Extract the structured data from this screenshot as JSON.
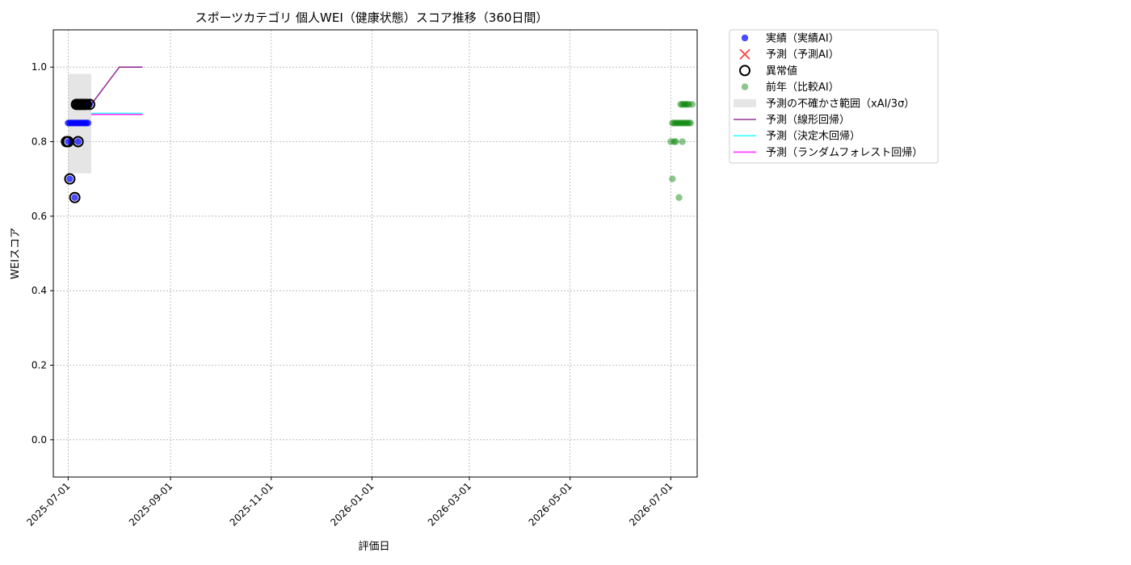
{
  "chart_data": {
    "type": "scatter",
    "title": "スポーツカテゴリ 個人WEI（健康状態）スコア推移（360日間）",
    "xlabel": "評価日",
    "ylabel": "WEIスコア",
    "x_type": "date",
    "xlim": [
      "2025-06-22",
      "2026-07-17"
    ],
    "ylim": [
      -0.1,
      1.1
    ],
    "x_ticks": [
      "2025-07-01",
      "2025-09-01",
      "2025-11-01",
      "2026-01-01",
      "2026-03-01",
      "2026-05-01",
      "2026-07-01"
    ],
    "y_ticks": [
      0.0,
      0.2,
      0.4,
      0.6,
      0.8,
      1.0
    ],
    "y_tick_labels": [
      "0.0",
      "0.2",
      "0.4",
      "0.6",
      "0.8",
      "1.0"
    ],
    "grid": true,
    "legend_position": "outside-top-right",
    "series": [
      {
        "name": "実績（実績AI）",
        "kind": "scatter",
        "color": "#0000ff",
        "points": [
          [
            "2025-07-01",
            0.85
          ],
          [
            "2025-07-01",
            0.8
          ],
          [
            "2025-07-02",
            0.85
          ],
          [
            "2025-07-02",
            0.7
          ],
          [
            "2025-07-03",
            0.85
          ],
          [
            "2025-07-03",
            0.8
          ],
          [
            "2025-07-04",
            0.85
          ],
          [
            "2025-07-05",
            0.65
          ],
          [
            "2025-07-05",
            0.85
          ],
          [
            "2025-07-06",
            0.85
          ],
          [
            "2025-07-06",
            0.9
          ],
          [
            "2025-07-07",
            0.8
          ],
          [
            "2025-07-07",
            0.85
          ],
          [
            "2025-07-08",
            0.85
          ],
          [
            "2025-07-08",
            0.9
          ],
          [
            "2025-07-09",
            0.85
          ],
          [
            "2025-07-09",
            0.9
          ],
          [
            "2025-07-10",
            0.85
          ],
          [
            "2025-07-10",
            0.9
          ],
          [
            "2025-07-11",
            0.85
          ],
          [
            "2025-07-11",
            0.9
          ],
          [
            "2025-07-12",
            0.85
          ],
          [
            "2025-07-13",
            0.85
          ],
          [
            "2025-07-13",
            0.9
          ],
          [
            "2025-07-14",
            0.9
          ]
        ]
      },
      {
        "name": "予測（予測AI）",
        "kind": "x-marker",
        "color": "#ff0000",
        "points": []
      },
      {
        "name": "異常値",
        "kind": "ring",
        "color": "#000000",
        "points": [
          [
            "2025-06-30",
            0.8
          ],
          [
            "2025-07-01",
            0.8
          ],
          [
            "2025-07-02",
            0.7
          ],
          [
            "2025-07-05",
            0.65
          ],
          [
            "2025-07-06",
            0.9
          ],
          [
            "2025-07-07",
            0.8
          ],
          [
            "2025-07-07",
            0.9
          ],
          [
            "2025-07-08",
            0.9
          ],
          [
            "2025-07-09",
            0.9
          ],
          [
            "2025-07-10",
            0.9
          ],
          [
            "2025-07-11",
            0.9
          ],
          [
            "2025-07-12",
            0.9
          ],
          [
            "2025-07-14",
            0.9
          ]
        ]
      },
      {
        "name": "前年（比較AI）",
        "kind": "scatter",
        "color": "#008000",
        "points": [
          [
            "2026-07-01",
            0.8
          ],
          [
            "2026-07-02",
            0.85
          ],
          [
            "2026-07-02",
            0.7
          ],
          [
            "2026-07-03",
            0.8
          ],
          [
            "2026-07-03",
            0.85
          ],
          [
            "2026-07-04",
            0.8
          ],
          [
            "2026-07-04",
            0.85
          ],
          [
            "2026-07-05",
            0.85
          ],
          [
            "2026-07-06",
            0.85
          ],
          [
            "2026-07-06",
            0.65
          ],
          [
            "2026-07-07",
            0.85
          ],
          [
            "2026-07-07",
            0.9
          ],
          [
            "2026-07-08",
            0.85
          ],
          [
            "2026-07-08",
            0.8
          ],
          [
            "2026-07-08",
            0.9
          ],
          [
            "2026-07-09",
            0.85
          ],
          [
            "2026-07-09",
            0.9
          ],
          [
            "2026-07-10",
            0.85
          ],
          [
            "2026-07-10",
            0.9
          ],
          [
            "2026-07-11",
            0.85
          ],
          [
            "2026-07-11",
            0.9
          ],
          [
            "2026-07-12",
            0.85
          ],
          [
            "2026-07-12",
            0.9
          ],
          [
            "2026-07-13",
            0.85
          ],
          [
            "2026-07-14",
            0.9
          ]
        ]
      },
      {
        "name": "予測の不確かさ範囲（xAI/3σ）",
        "kind": "band",
        "color": "#cccccc",
        "x_range": [
          "2025-07-01",
          "2025-07-15"
        ],
        "y_range": [
          0.715,
          0.982
        ]
      },
      {
        "name": "予測（線形回帰）",
        "kind": "line",
        "color": "#800080",
        "points": [
          [
            "2025-07-15",
            0.9
          ],
          [
            "2025-08-01",
            1.0
          ],
          [
            "2025-08-15",
            1.0
          ]
        ]
      },
      {
        "name": "予測（決定木回帰）",
        "kind": "line",
        "color": "#00ffff",
        "points": [
          [
            "2025-07-15",
            0.876
          ],
          [
            "2025-08-15",
            0.876
          ]
        ]
      },
      {
        "name": "予測（ランダムフォレスト回帰）",
        "kind": "line",
        "color": "#ff00ff",
        "points": [
          [
            "2025-07-15",
            0.873
          ],
          [
            "2025-08-15",
            0.873
          ]
        ]
      }
    ]
  }
}
